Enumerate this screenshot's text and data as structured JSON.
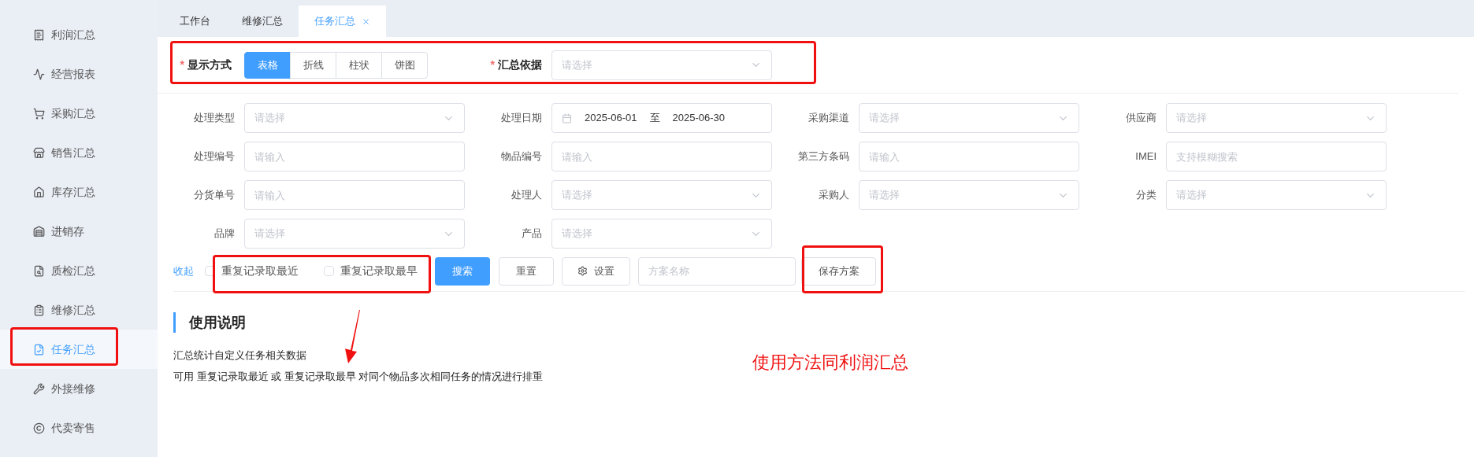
{
  "sidebar": {
    "items": [
      {
        "label": "利润汇总",
        "selected": false
      },
      {
        "label": "经营报表",
        "selected": false
      },
      {
        "label": "采购汇总",
        "selected": false
      },
      {
        "label": "销售汇总",
        "selected": false
      },
      {
        "label": "库存汇总",
        "selected": false
      },
      {
        "label": "进销存",
        "selected": false
      },
      {
        "label": "质检汇总",
        "selected": false
      },
      {
        "label": "维修汇总",
        "selected": false
      },
      {
        "label": "任务汇总",
        "selected": true
      },
      {
        "label": "外接维修",
        "selected": false
      },
      {
        "label": "代卖寄售",
        "selected": false
      }
    ]
  },
  "tabs": [
    {
      "label": "工作台",
      "selected": false
    },
    {
      "label": "维修汇总",
      "selected": false
    },
    {
      "label": "任务汇总",
      "selected": true
    }
  ],
  "display": {
    "label": "显示方式",
    "marker": "*",
    "options": [
      {
        "label": "表格",
        "selected": true
      },
      {
        "label": "折线",
        "selected": false
      },
      {
        "label": "柱状",
        "selected": false
      },
      {
        "label": "饼图",
        "selected": false
      }
    ],
    "basis": {
      "label": "汇总依据",
      "marker": "*",
      "placeholder": "请选择"
    }
  },
  "filters": [
    {
      "label": "处理类型",
      "kind": "select",
      "placeholder": "请选择"
    },
    {
      "label": "处理日期",
      "kind": "daterange",
      "start": "2025-06-01",
      "separator": "至",
      "end": "2025-06-30"
    },
    {
      "label": "采购渠道",
      "kind": "select",
      "placeholder": "请选择"
    },
    {
      "label": "供应商",
      "kind": "select",
      "placeholder": "请选择"
    },
    {
      "label": "处理编号",
      "kind": "input",
      "placeholder": "请输入"
    },
    {
      "label": "物品编号",
      "kind": "input",
      "placeholder": "请输入"
    },
    {
      "label": "第三方条码",
      "kind": "input",
      "placeholder": "请输入"
    },
    {
      "label": "IMEI",
      "kind": "input",
      "placeholder": "支持模糊搜索"
    },
    {
      "label": "分货单号",
      "kind": "input",
      "placeholder": "请输入"
    },
    {
      "label": "处理人",
      "kind": "select",
      "placeholder": "请选择"
    },
    {
      "label": "采购人",
      "kind": "select",
      "placeholder": "请选择"
    },
    {
      "label": "分类",
      "kind": "select",
      "placeholder": "请选择"
    },
    {
      "label": "品牌",
      "kind": "select",
      "placeholder": "请选择"
    },
    {
      "label": "产品",
      "kind": "select",
      "placeholder": "请选择"
    }
  ],
  "actions": {
    "collapse": "收起",
    "checkboxes": [
      {
        "label": "重复记录取最近",
        "checked": false
      },
      {
        "label": "重复记录取最早",
        "checked": false
      }
    ],
    "search": "搜索",
    "reset": "重置",
    "settings": "设置",
    "scheme_placeholder": "方案名称",
    "save": "保存方案"
  },
  "instructions": {
    "title": "使用说明",
    "lines": [
      "汇总统计自定义任务相关数据",
      "可用 重复记录取最近 或 重复记录取最早 对同个物品多次相同任务的情况进行排重"
    ]
  },
  "annotation": {
    "note": "使用方法同利润汇总"
  }
}
